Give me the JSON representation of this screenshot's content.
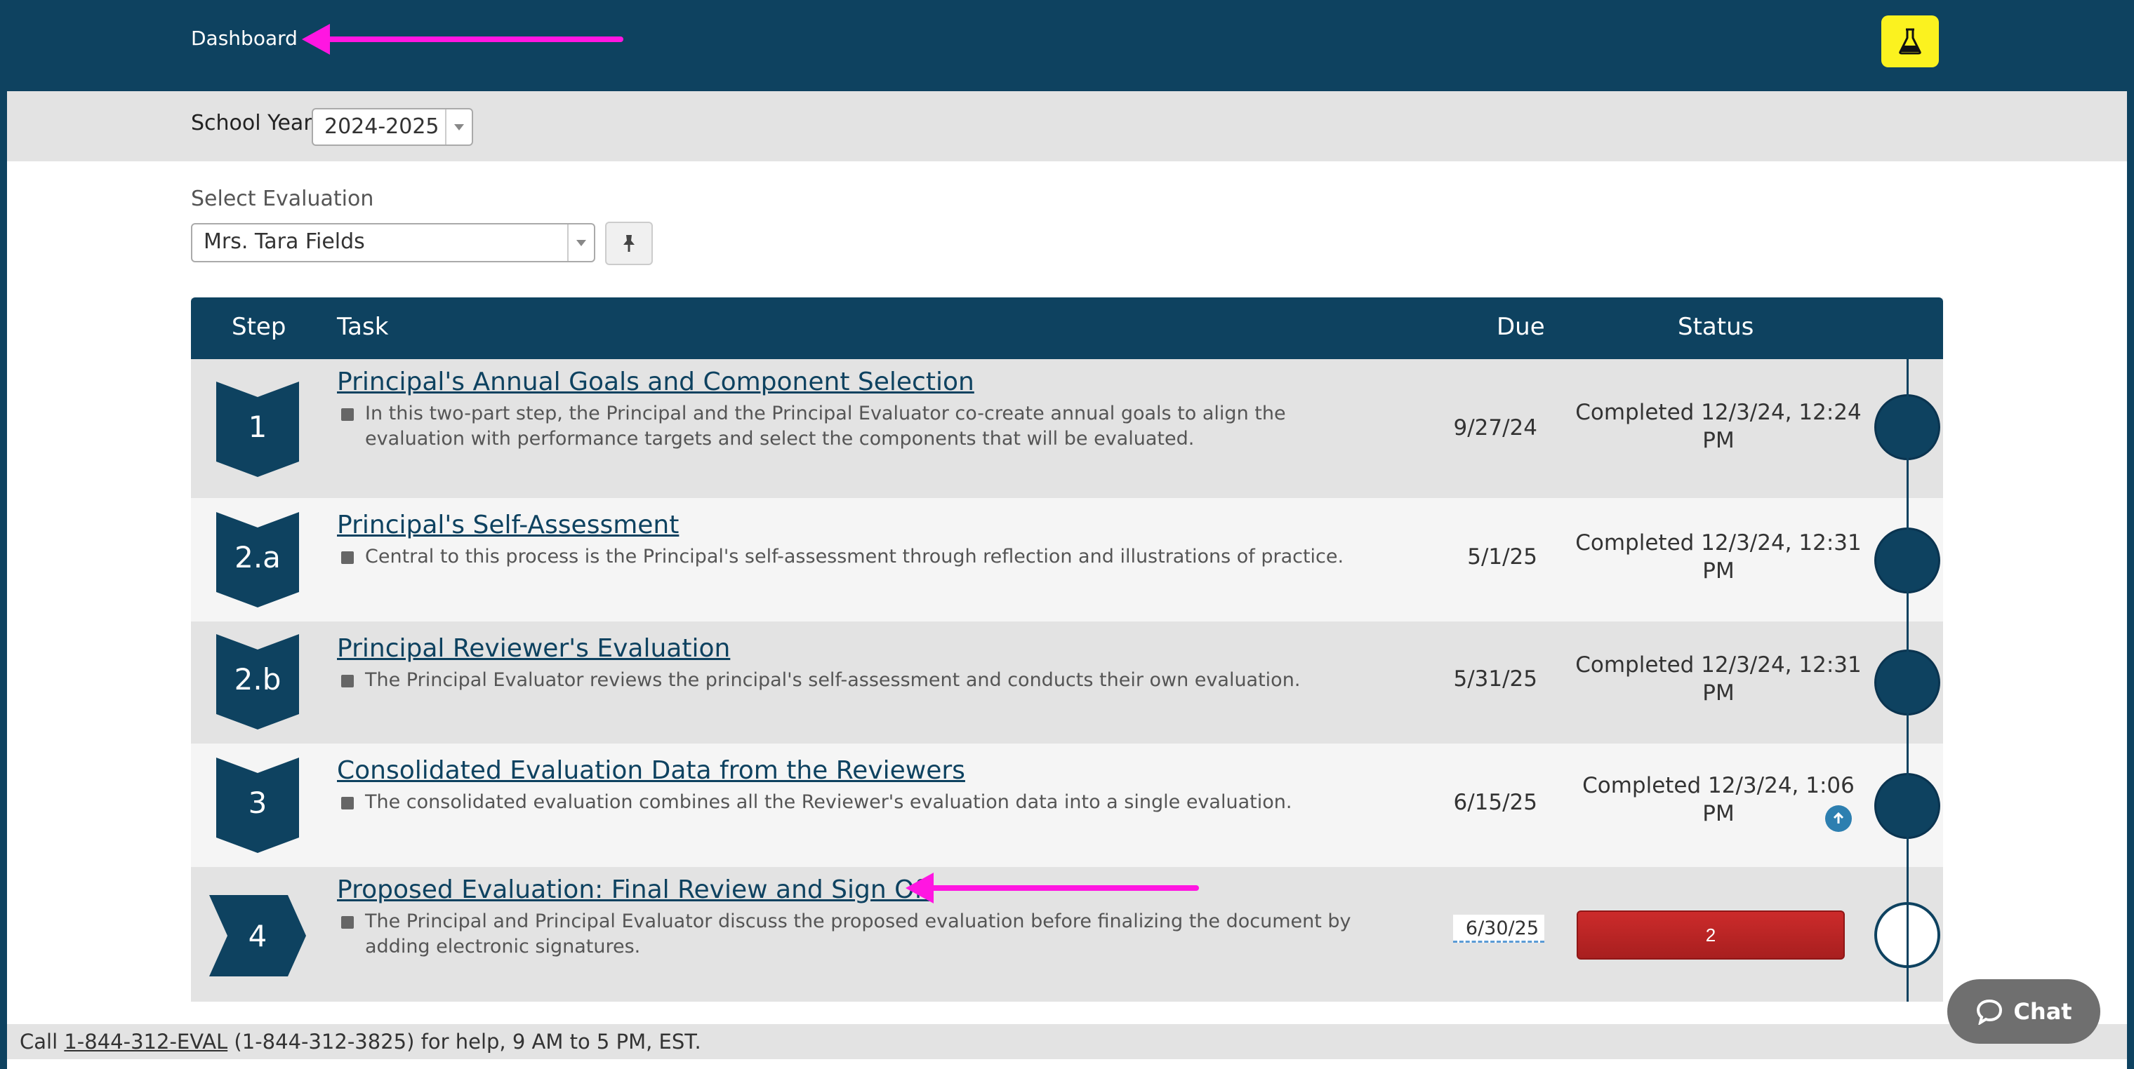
{
  "header": {
    "dashboard_label": "Dashboard",
    "lab_icon": "flask-icon"
  },
  "school_year": {
    "label": "School Year:",
    "value": "2024-2025"
  },
  "evaluation": {
    "label": "Select Evaluation",
    "value": "Mrs. Tara Fields",
    "pin_icon": "pushpin-icon"
  },
  "table": {
    "headers": {
      "step": "Step",
      "task": "Task",
      "due": "Due",
      "status": "Status"
    },
    "rows": [
      {
        "step": "1",
        "title": "Principal's Annual Goals and Component Selection",
        "desc": "In this two-part step, the Principal and the Principal Evaluator co-create annual goals to align the evaluation with performance targets and select the components that will be evaluated.",
        "due": "9/27/24",
        "status": "Completed 12/3/24, 12:24 PM"
      },
      {
        "step": "2.a",
        "title": "Principal's Self-Assessment",
        "desc": "Central to this process is the Principal's self-assessment through reflection and illustrations of practice.",
        "due": "5/1/25",
        "status": "Completed 12/3/24, 12:31 PM"
      },
      {
        "step": "2.b",
        "title": "Principal Reviewer's Evaluation",
        "desc": "The Principal Evaluator reviews the principal's self-assessment and conducts their own evaluation.",
        "due": "5/31/25",
        "status": "Completed 12/3/24, 12:31 PM"
      },
      {
        "step": "3",
        "title": "Consolidated Evaluation Data from the Reviewers",
        "desc": "The consolidated evaluation combines all the Reviewer's evaluation data into a single evaluation.",
        "due": "6/15/25",
        "status": "Completed 12/3/24, 1:06 PM"
      },
      {
        "step": "4",
        "title": "Proposed Evaluation: Final Review and Sign Off",
        "desc": "The Principal and Principal Evaluator discuss the proposed evaluation before finalizing the document by adding electronic signatures.",
        "due": "6/30/25",
        "status_button": "2"
      }
    ]
  },
  "footer": {
    "prefix": "Call ",
    "phone_link": "1-844-312-EVAL",
    "suffix": " (1-844-312-3825) for help, 9 AM to 5 PM, EST."
  },
  "chat": {
    "label": "Chat"
  },
  "colors": {
    "navy": "#0e4260",
    "yellow": "#fbf21f",
    "red": "#b82424",
    "magenta_arrow": "#ff16e1"
  }
}
